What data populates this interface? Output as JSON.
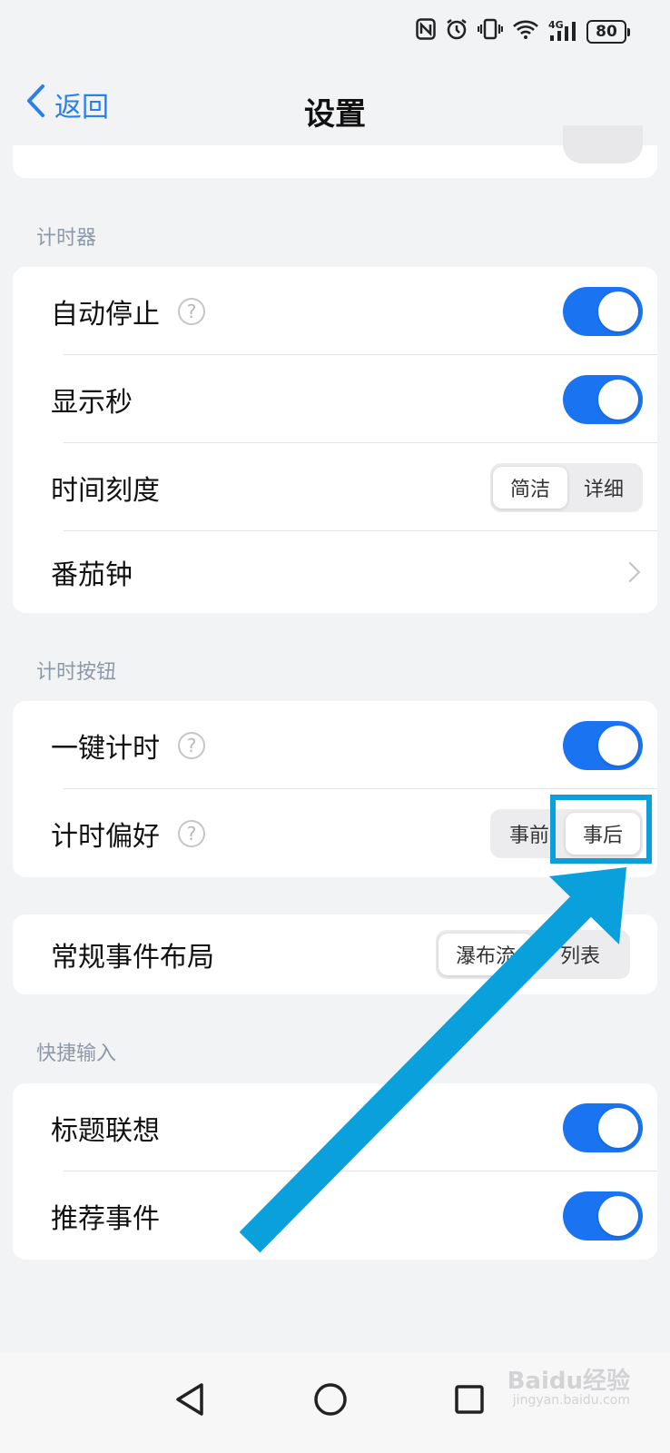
{
  "status_bar": {
    "icons": [
      "nfc-icon",
      "alarm-icon",
      "vibrate-icon",
      "wifi-icon",
      "signal-4g-icon"
    ],
    "network": "4G",
    "battery": "80"
  },
  "nav": {
    "back_label": "返回",
    "title": "设置"
  },
  "sections": {
    "timer": {
      "header": "计时器",
      "auto_stop": {
        "label": "自动停止",
        "on": true
      },
      "show_seconds": {
        "label": "显示秒",
        "on": true
      },
      "time_scale": {
        "label": "时间刻度",
        "options": [
          "简洁",
          "详细"
        ],
        "selected": "简洁"
      },
      "pomodoro": {
        "label": "番茄钟"
      }
    },
    "timer_button": {
      "header": "计时按钮",
      "one_key": {
        "label": "一键计时",
        "on": true
      },
      "preference": {
        "label": "计时偏好",
        "options": [
          "事前",
          "事后"
        ],
        "selected": "事后"
      }
    },
    "layout": {
      "event_layout": {
        "label": "常规事件布局",
        "options": [
          "瀑布流",
          "列表"
        ],
        "selected": "瀑布流"
      }
    },
    "quick_input": {
      "header": "快捷输入",
      "title_suggest": {
        "label": "标题联想",
        "on": true
      },
      "recommend": {
        "label": "推荐事件",
        "on": true
      }
    }
  },
  "colors": {
    "accent": "#1a73f0",
    "annotation": "#0aa0dc",
    "section_header": "#8e99a8"
  },
  "watermark": {
    "brand": "Baidu经验",
    "url": "jingyan.baidu.com"
  }
}
